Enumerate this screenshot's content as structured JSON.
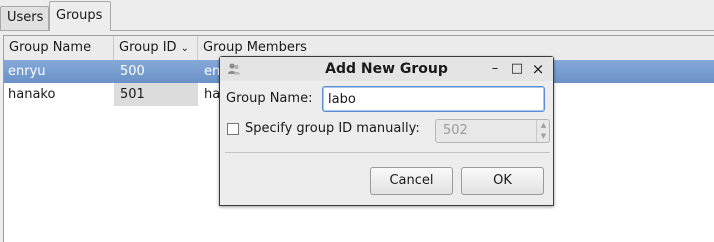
{
  "tabs": [
    {
      "label": "Users"
    },
    {
      "label": "Groups"
    }
  ],
  "table": {
    "columns": [
      "Group Name",
      "Group ID",
      "Group Members"
    ],
    "rows": [
      {
        "name": "enryu",
        "id": "500",
        "members": "en"
      },
      {
        "name": "hanako",
        "id": "501",
        "members": "ha"
      }
    ]
  },
  "dialog": {
    "title": "Add New Group",
    "group_name_label": "Group Name:",
    "group_name_value": "labo",
    "specify_id_label": "Specify group ID manually:",
    "group_id_value": "502",
    "cancel_label": "Cancel",
    "ok_label": "OK",
    "titlebar_buttons": {
      "minimize": "–",
      "maximize": "□",
      "close": "×"
    }
  },
  "colors": {
    "selection": "#7a9fd2",
    "focus_border": "#5b8fd4"
  }
}
